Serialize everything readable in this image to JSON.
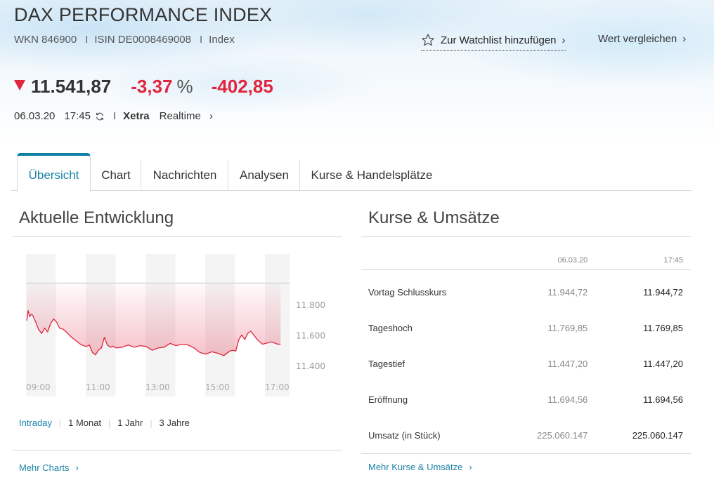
{
  "header": {
    "title": "DAX PERFORMANCE INDEX",
    "wkn": "WKN 846900",
    "isin": "ISIN DE0008469008",
    "type": "Index",
    "watchlist_label": "Zur Watchlist hinzufügen",
    "compare_label": "Wert vergleichen"
  },
  "quote": {
    "direction": "down",
    "price": "11.541,87",
    "change_pct": "-3,37",
    "pct_sign": "%",
    "change_abs": "-402,85",
    "date": "06.03.20",
    "time": "17:45",
    "exchange": "Xetra",
    "feed": "Realtime",
    "negative_color": "#e0263f"
  },
  "tabs": [
    {
      "label": "Übersicht",
      "active": true
    },
    {
      "label": "Chart",
      "active": false
    },
    {
      "label": "Nachrichten",
      "active": false
    },
    {
      "label": "Analysen",
      "active": false
    },
    {
      "label": "Kurse & Handelsplätze",
      "active": false
    }
  ],
  "development": {
    "title": "Aktuelle Entwicklung",
    "periods": [
      {
        "label": "Intraday",
        "active": true
      },
      {
        "label": "1 Monat",
        "active": false
      },
      {
        "label": "1 Jahr",
        "active": false
      },
      {
        "label": "3 Jahre",
        "active": false
      }
    ],
    "more_label": "Mehr Charts"
  },
  "chart_data": {
    "type": "area",
    "title": "",
    "xlabel": "",
    "ylabel": "",
    "x_ticks": [
      "09:00",
      "11:00",
      "13:00",
      "15:00",
      "17:00"
    ],
    "y_ticks": [
      "11.800",
      "11.600",
      "11.400"
    ],
    "y_tick_values": [
      11800,
      11600,
      11400
    ],
    "xlim_hours": [
      9.0,
      17.5
    ],
    "ylim": [
      11300,
      11980
    ],
    "reference_line": {
      "label": "Vortag Schlusskurs",
      "value": 11944.72
    },
    "grid": "alternating vertical bands per hour",
    "line_color": "#e0263f",
    "series": [
      {
        "name": "DAX Intraday",
        "x_hours": [
          9.0,
          9.05,
          9.1,
          9.15,
          9.2,
          9.3,
          9.4,
          9.5,
          9.6,
          9.7,
          9.8,
          9.9,
          10.0,
          10.1,
          10.2,
          10.3,
          10.4,
          10.5,
          10.6,
          10.7,
          10.8,
          10.9,
          11.0,
          11.1,
          11.2,
          11.3,
          11.4,
          11.5,
          11.6,
          11.7,
          11.8,
          11.9,
          12.0,
          12.2,
          12.4,
          12.6,
          12.8,
          13.0,
          13.2,
          13.4,
          13.6,
          13.8,
          14.0,
          14.2,
          14.4,
          14.6,
          14.8,
          15.0,
          15.2,
          15.4,
          15.6,
          15.8,
          15.9,
          16.0,
          16.1,
          16.2,
          16.3,
          16.4,
          16.5,
          16.6,
          16.7,
          16.8,
          16.9,
          17.0,
          17.2,
          17.4,
          17.5
        ],
        "values": [
          11700,
          11765,
          11725,
          11740,
          11735,
          11690,
          11640,
          11615,
          11650,
          11625,
          11680,
          11710,
          11690,
          11650,
          11645,
          11630,
          11610,
          11590,
          11575,
          11560,
          11545,
          11535,
          11530,
          11540,
          11490,
          11475,
          11505,
          11520,
          11590,
          11540,
          11525,
          11530,
          11520,
          11525,
          11540,
          11525,
          11535,
          11530,
          11505,
          11520,
          11525,
          11550,
          11535,
          11545,
          11540,
          11520,
          11490,
          11480,
          11495,
          11485,
          11470,
          11500,
          11505,
          11500,
          11575,
          11605,
          11575,
          11615,
          11630,
          11605,
          11580,
          11560,
          11545,
          11550,
          11560,
          11545,
          11545
        ]
      }
    ]
  },
  "prices": {
    "title": "Kurse & Umsätze",
    "columns": [
      "",
      "06.03.20",
      "17:45"
    ],
    "rows": [
      {
        "label": "Vortag Schlusskurs",
        "col1": "11.944,72",
        "col2": "11.944,72"
      },
      {
        "label": "Tageshoch",
        "col1": "11.769,85",
        "col2": "11.769,85"
      },
      {
        "label": "Tagestief",
        "col1": "11.447,20",
        "col2": "11.447,20"
      },
      {
        "label": "Eröffnung",
        "col1": "11.694,56",
        "col2": "11.694,56"
      },
      {
        "label": "Umsatz (in Stück)",
        "col1": "225.060.147",
        "col2": "225.060.147"
      }
    ],
    "more_label": "Mehr Kurse & Umsätze"
  },
  "icons": {
    "watchlist": "star-outline-icon",
    "chevron": "chevron-right-icon",
    "refresh": "refresh-icon",
    "down": "triangle-down-icon"
  }
}
